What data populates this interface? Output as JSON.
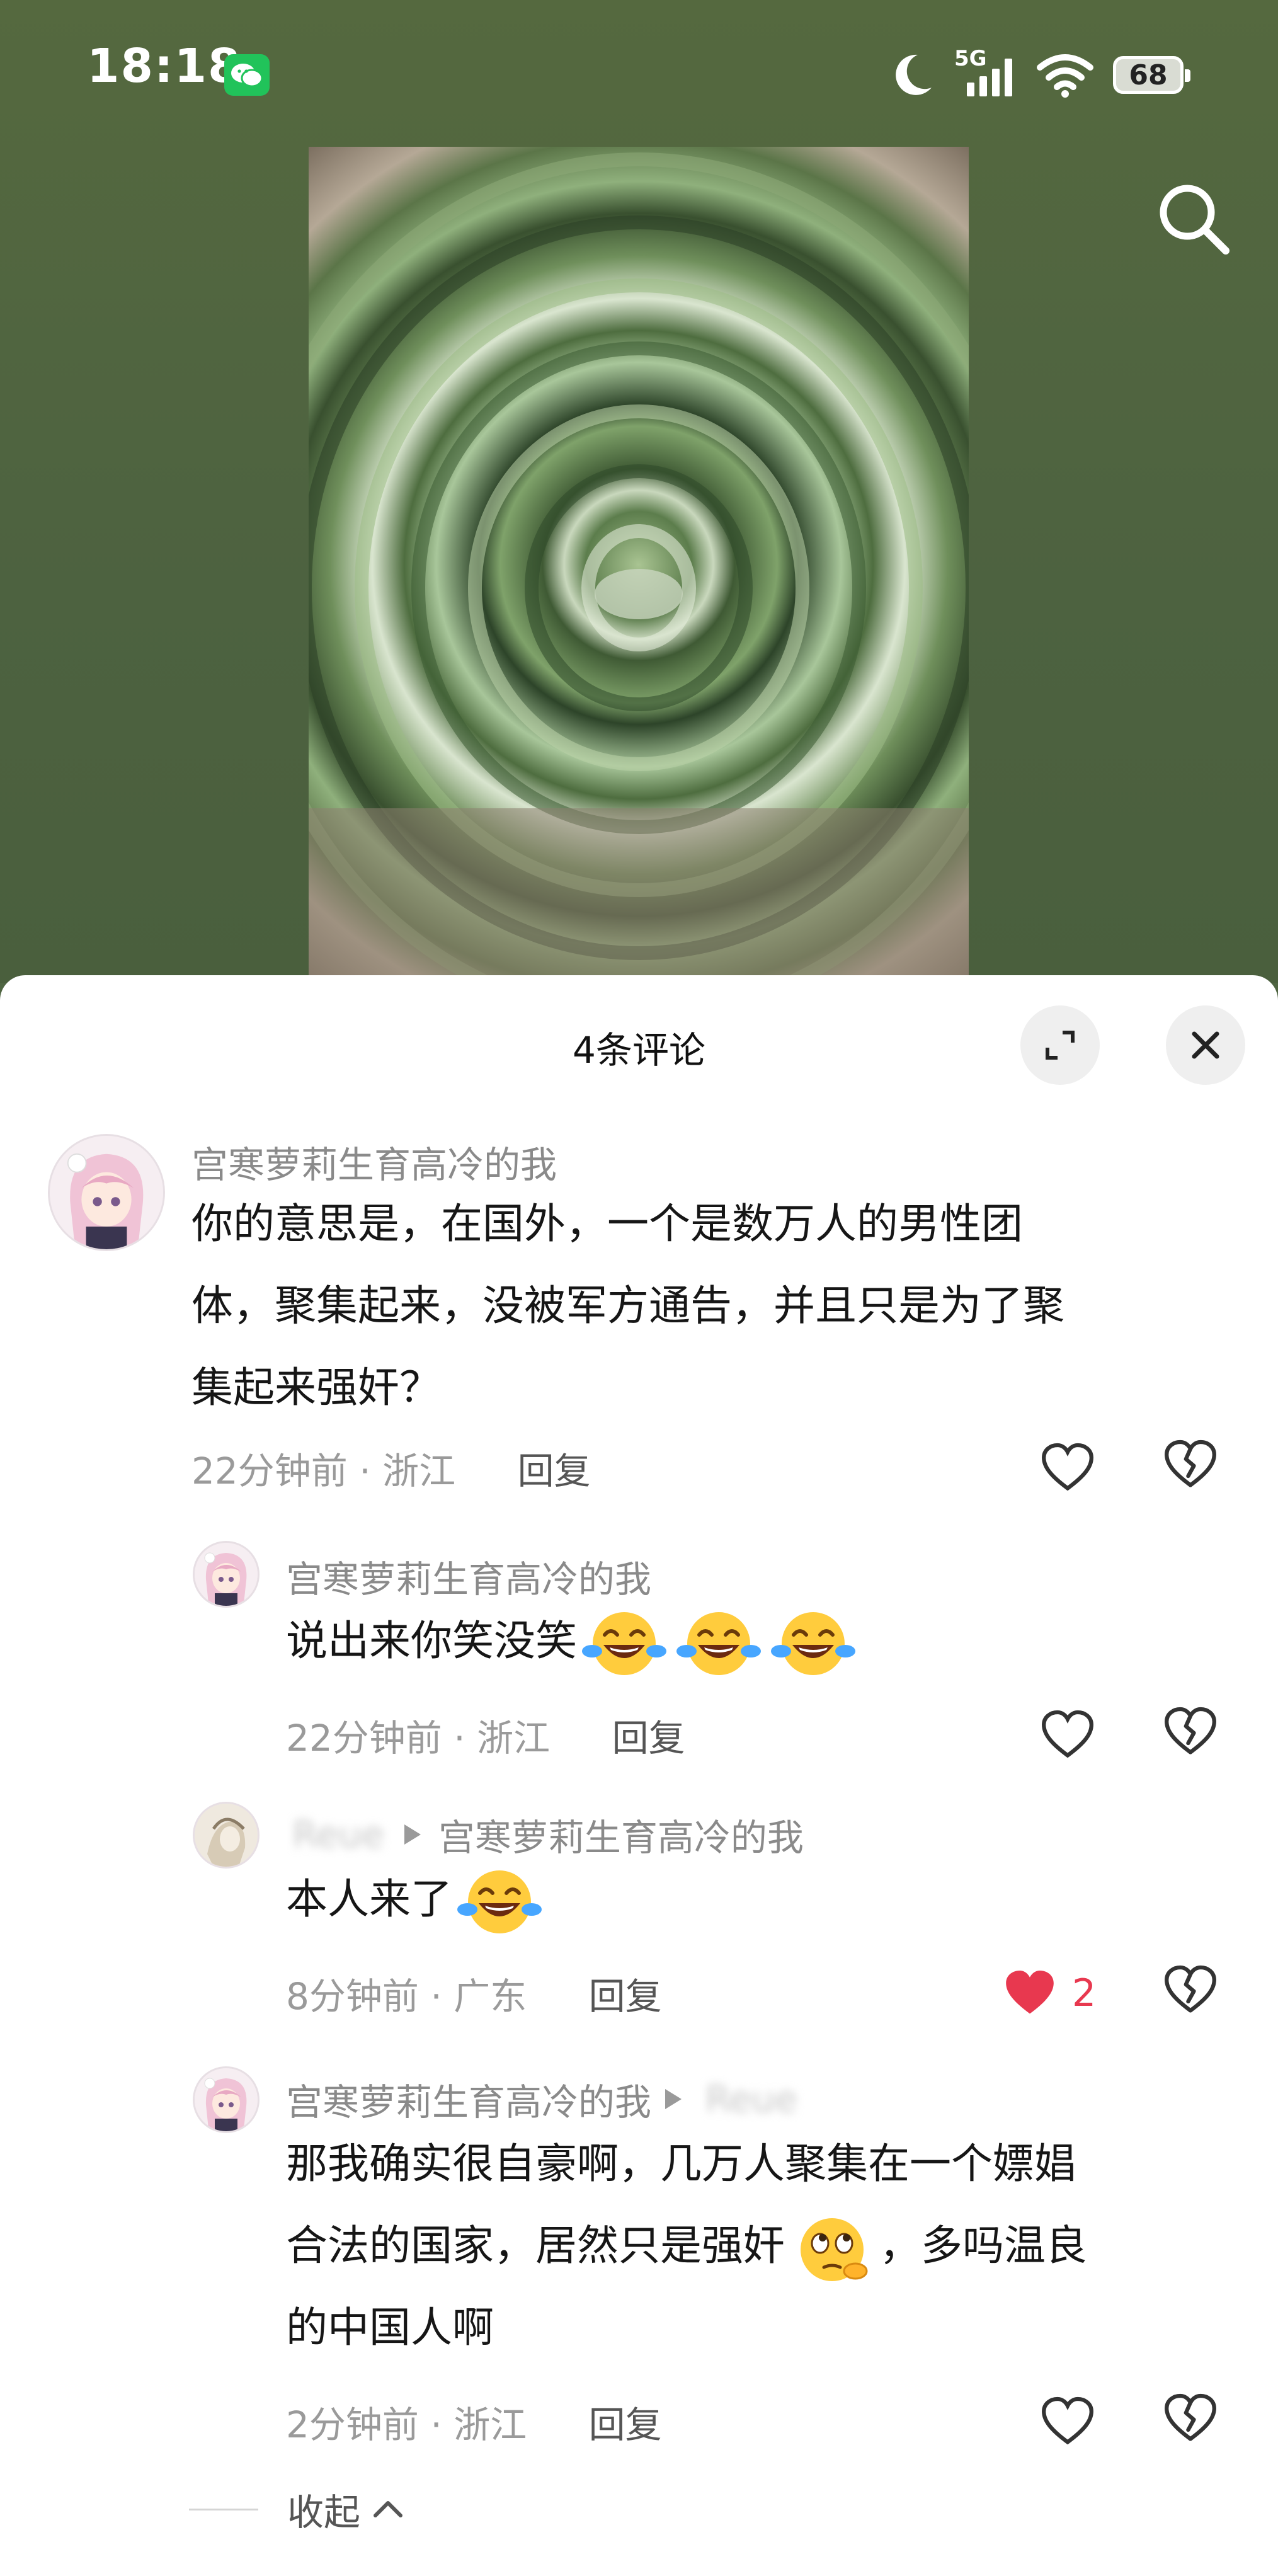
{
  "status_bar": {
    "time": "18:18",
    "network": "5G",
    "battery": "68",
    "icons": [
      "wechat-icon",
      "moon-icon",
      "signal-icon",
      "wifi-icon",
      "battery-icon"
    ]
  },
  "header": {
    "search_icon": "search-icon"
  },
  "comments_panel": {
    "title": "4条评论",
    "expand_icon": "expand-icon",
    "close_icon": "close-icon",
    "collapse_label": "收起"
  },
  "comments": [
    {
      "user": "宫寒萝莉生育高冷的我",
      "lines": [
        "你的意思是，在国外，一个是数万人的男性团",
        "体，聚集起来，没被军方通告，并且只是为了聚",
        "集起来强奸？"
      ],
      "time": "22分钟前",
      "location": "浙江",
      "reply": "回复",
      "likes": ""
    },
    {
      "user": "宫寒萝莉生育高冷的我",
      "text": "说出来你笑没笑",
      "emojis": [
        "tears-of-joy-emoji",
        "tears-of-joy-emoji",
        "tears-of-joy-emoji"
      ],
      "time": "22分钟前",
      "location": "浙江",
      "reply": "回复",
      "likes": ""
    },
    {
      "user": "Reue",
      "reply_to": "宫寒萝莉生育高冷的我",
      "text": "本人来了",
      "emojis": [
        "tears-of-joy-emoji"
      ],
      "time": "8分钟前",
      "location": "广东",
      "reply": "回复",
      "likes": "2"
    },
    {
      "user": "宫寒萝莉生育高冷的我",
      "reply_to": "Reue",
      "lines": [
        "那我确实很自豪啊，几万人聚集在一个嫖娼",
        "合法的国家，居然只是强奸",
        "，多吗温良",
        "的中国人啊"
      ],
      "emojis": [
        "rolling-eyes-emoji"
      ],
      "time": "2分钟前",
      "location": "浙江",
      "reply": "回复",
      "likes": ""
    }
  ],
  "colors": {
    "background": "#4f6542",
    "like_red": "#e8384f",
    "meta_gray": "#9a9a9a",
    "wechat_green": "#21c35a"
  }
}
